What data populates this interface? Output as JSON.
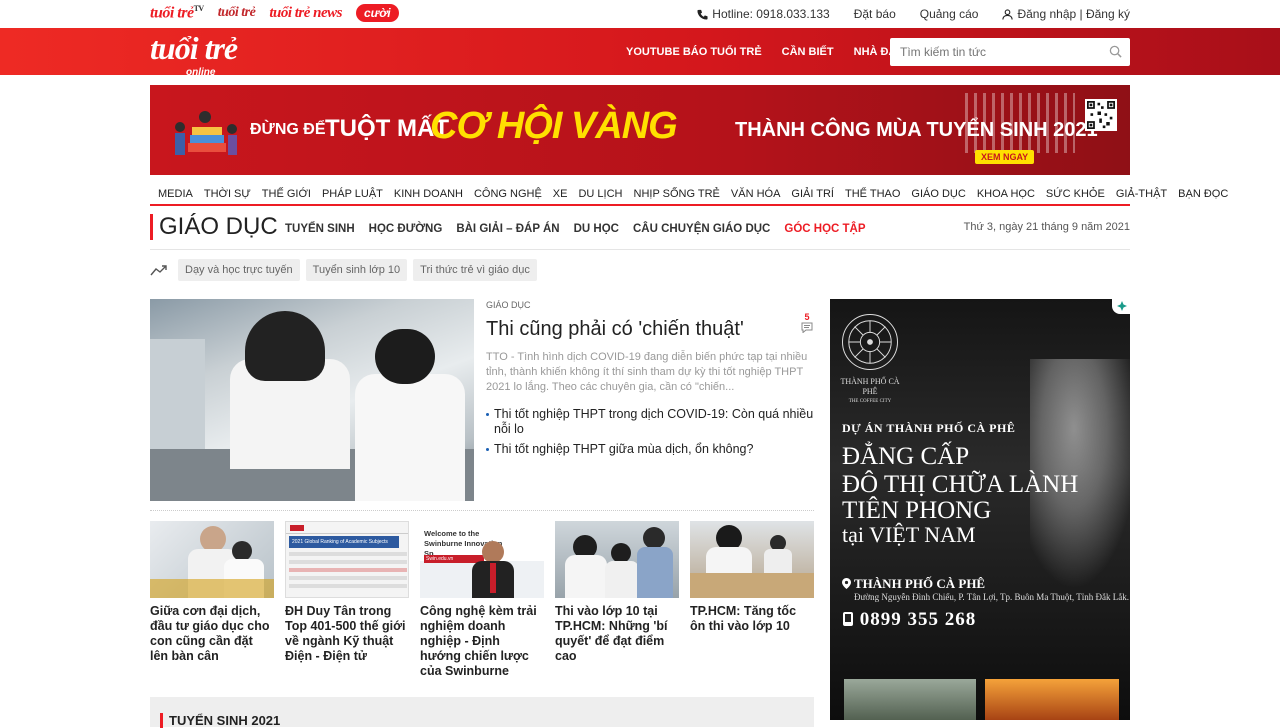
{
  "topbar": {
    "logos": [
      "tuổi trẻ",
      "tuổi trẻ",
      "tuổi trẻ news",
      "cười"
    ],
    "logo_tv": "TV",
    "hotline": "Hotline: 0918.033.133",
    "links": [
      "Đặt báo",
      "Quảng cáo"
    ],
    "login": "Đăng nhập | Đăng ký"
  },
  "header": {
    "logo": "tuổi trẻ",
    "logo_sub": "online",
    "nav": [
      "YOUTUBE BÁO TUỔI TRẺ",
      "CẦN BIẾT",
      "NHÀ ĐẤT"
    ],
    "search_placeholder": "Tìm kiếm tin tức"
  },
  "banner": {
    "t1": "ĐỪNG ĐỂ",
    "t2": "TUỘT MẤT",
    "t3": "CƠ HỘI VÀNG",
    "t4": "THÀNH CÔNG MÙA TUYỂN SINH 2021",
    "cta": "XEM NGAY"
  },
  "categories": [
    "MEDIA",
    "THỜI SỰ",
    "THẾ GIỚI",
    "PHÁP LUẬT",
    "KINH DOANH",
    "CÔNG NGHỆ",
    "XE",
    "DU LỊCH",
    "NHỊP SỐNG TRẺ",
    "VĂN HÓA",
    "GIẢI TRÍ",
    "THỂ THAO",
    "GIÁO DỤC",
    "KHOA HỌC",
    "SỨC KHỎE",
    "GIẢ-THẬT",
    "BẠN ĐỌC"
  ],
  "section": {
    "title": "GIÁO DỤC",
    "subnav": [
      "TUYỂN SINH",
      "HỌC ĐƯỜNG",
      "BÀI GIẢI – ĐÁP ÁN",
      "DU HỌC",
      "CÂU CHUYỆN GIÁO DỤC",
      "GÓC HỌC TẬP"
    ],
    "date": "Thứ 3, ngày 21 tháng 9 năm 2021"
  },
  "tags": [
    "Dạy và học trực tuyến",
    "Tuyển sinh lớp 10",
    "Tri thức trẻ vì giáo dục"
  ],
  "featured": {
    "category": "GIÁO DỤC",
    "title": "Thi cũng phải có 'chiến thuật'",
    "comments": "5",
    "summary": "TTO - Tình hình dịch COVID-19 đang diễn biến phức tạp tại nhiều tỉnh, thành khiến không ít thí sinh tham dự kỳ thi tốt nghiệp THPT 2021 lo lắng. Theo các chuyên gia, cần có \"chiến...",
    "related": [
      "Thi tốt nghiệp THPT trong dịch COVID-19: Còn quá nhiều nỗi lo",
      "Thi tốt nghiệp THPT giữa mùa dịch, ổn không?"
    ]
  },
  "cards": [
    {
      "title": "Giữa cơn đại dịch, đầu tư giáo dục cho con cũng cần đặt lên bàn cân"
    },
    {
      "title": "ĐH Duy Tân trong Top 401-500 thế giới về ngành Kỹ thuật Điện - Điện tử"
    },
    {
      "title": "Công nghệ kèm trải nghiệm doanh nghiệp - Định hướng chiến lược của Swinburne"
    },
    {
      "title": "Thi vào lớp 10 tại TP.HCM: Những 'bí quyết' để đạt điểm cao"
    },
    {
      "title": "TP.HCM: Tăng tốc ôn thi vào lớp 10"
    }
  ],
  "card_images": {
    "rank_header": "2021 Global Ranking of Academic Subjects",
    "swin_text": "Welcome to the Swinburne Innovation Sp",
    "swin_url": "Swin.edu.vn"
  },
  "bottom_section": "TUYỂN SINH 2021",
  "ad": {
    "city": "THÀNH PHỐ CÀ PHÊ",
    "city_sub": "THE COFFEE CITY",
    "l1": "DỰ ÁN THÀNH PHỐ CÀ PHÊ",
    "l2": "ĐẲNG CẤP",
    "l3": "ĐÔ THỊ CHỮA LÀNH",
    "l4": "TIÊN PHONG",
    "l5": "tại VIỆT NAM",
    "l6": "THÀNH PHỐ CÀ PHÊ",
    "l7": "Đường Nguyễn Đình Chiểu, P. Tân Lợi, Tp. Buôn Ma Thuột, Tỉnh Đắk Lắk.",
    "phone": "0899 355 268"
  },
  "colors": {
    "brand_red": "#ed1c24",
    "banner_yellow": "#ffe000"
  }
}
